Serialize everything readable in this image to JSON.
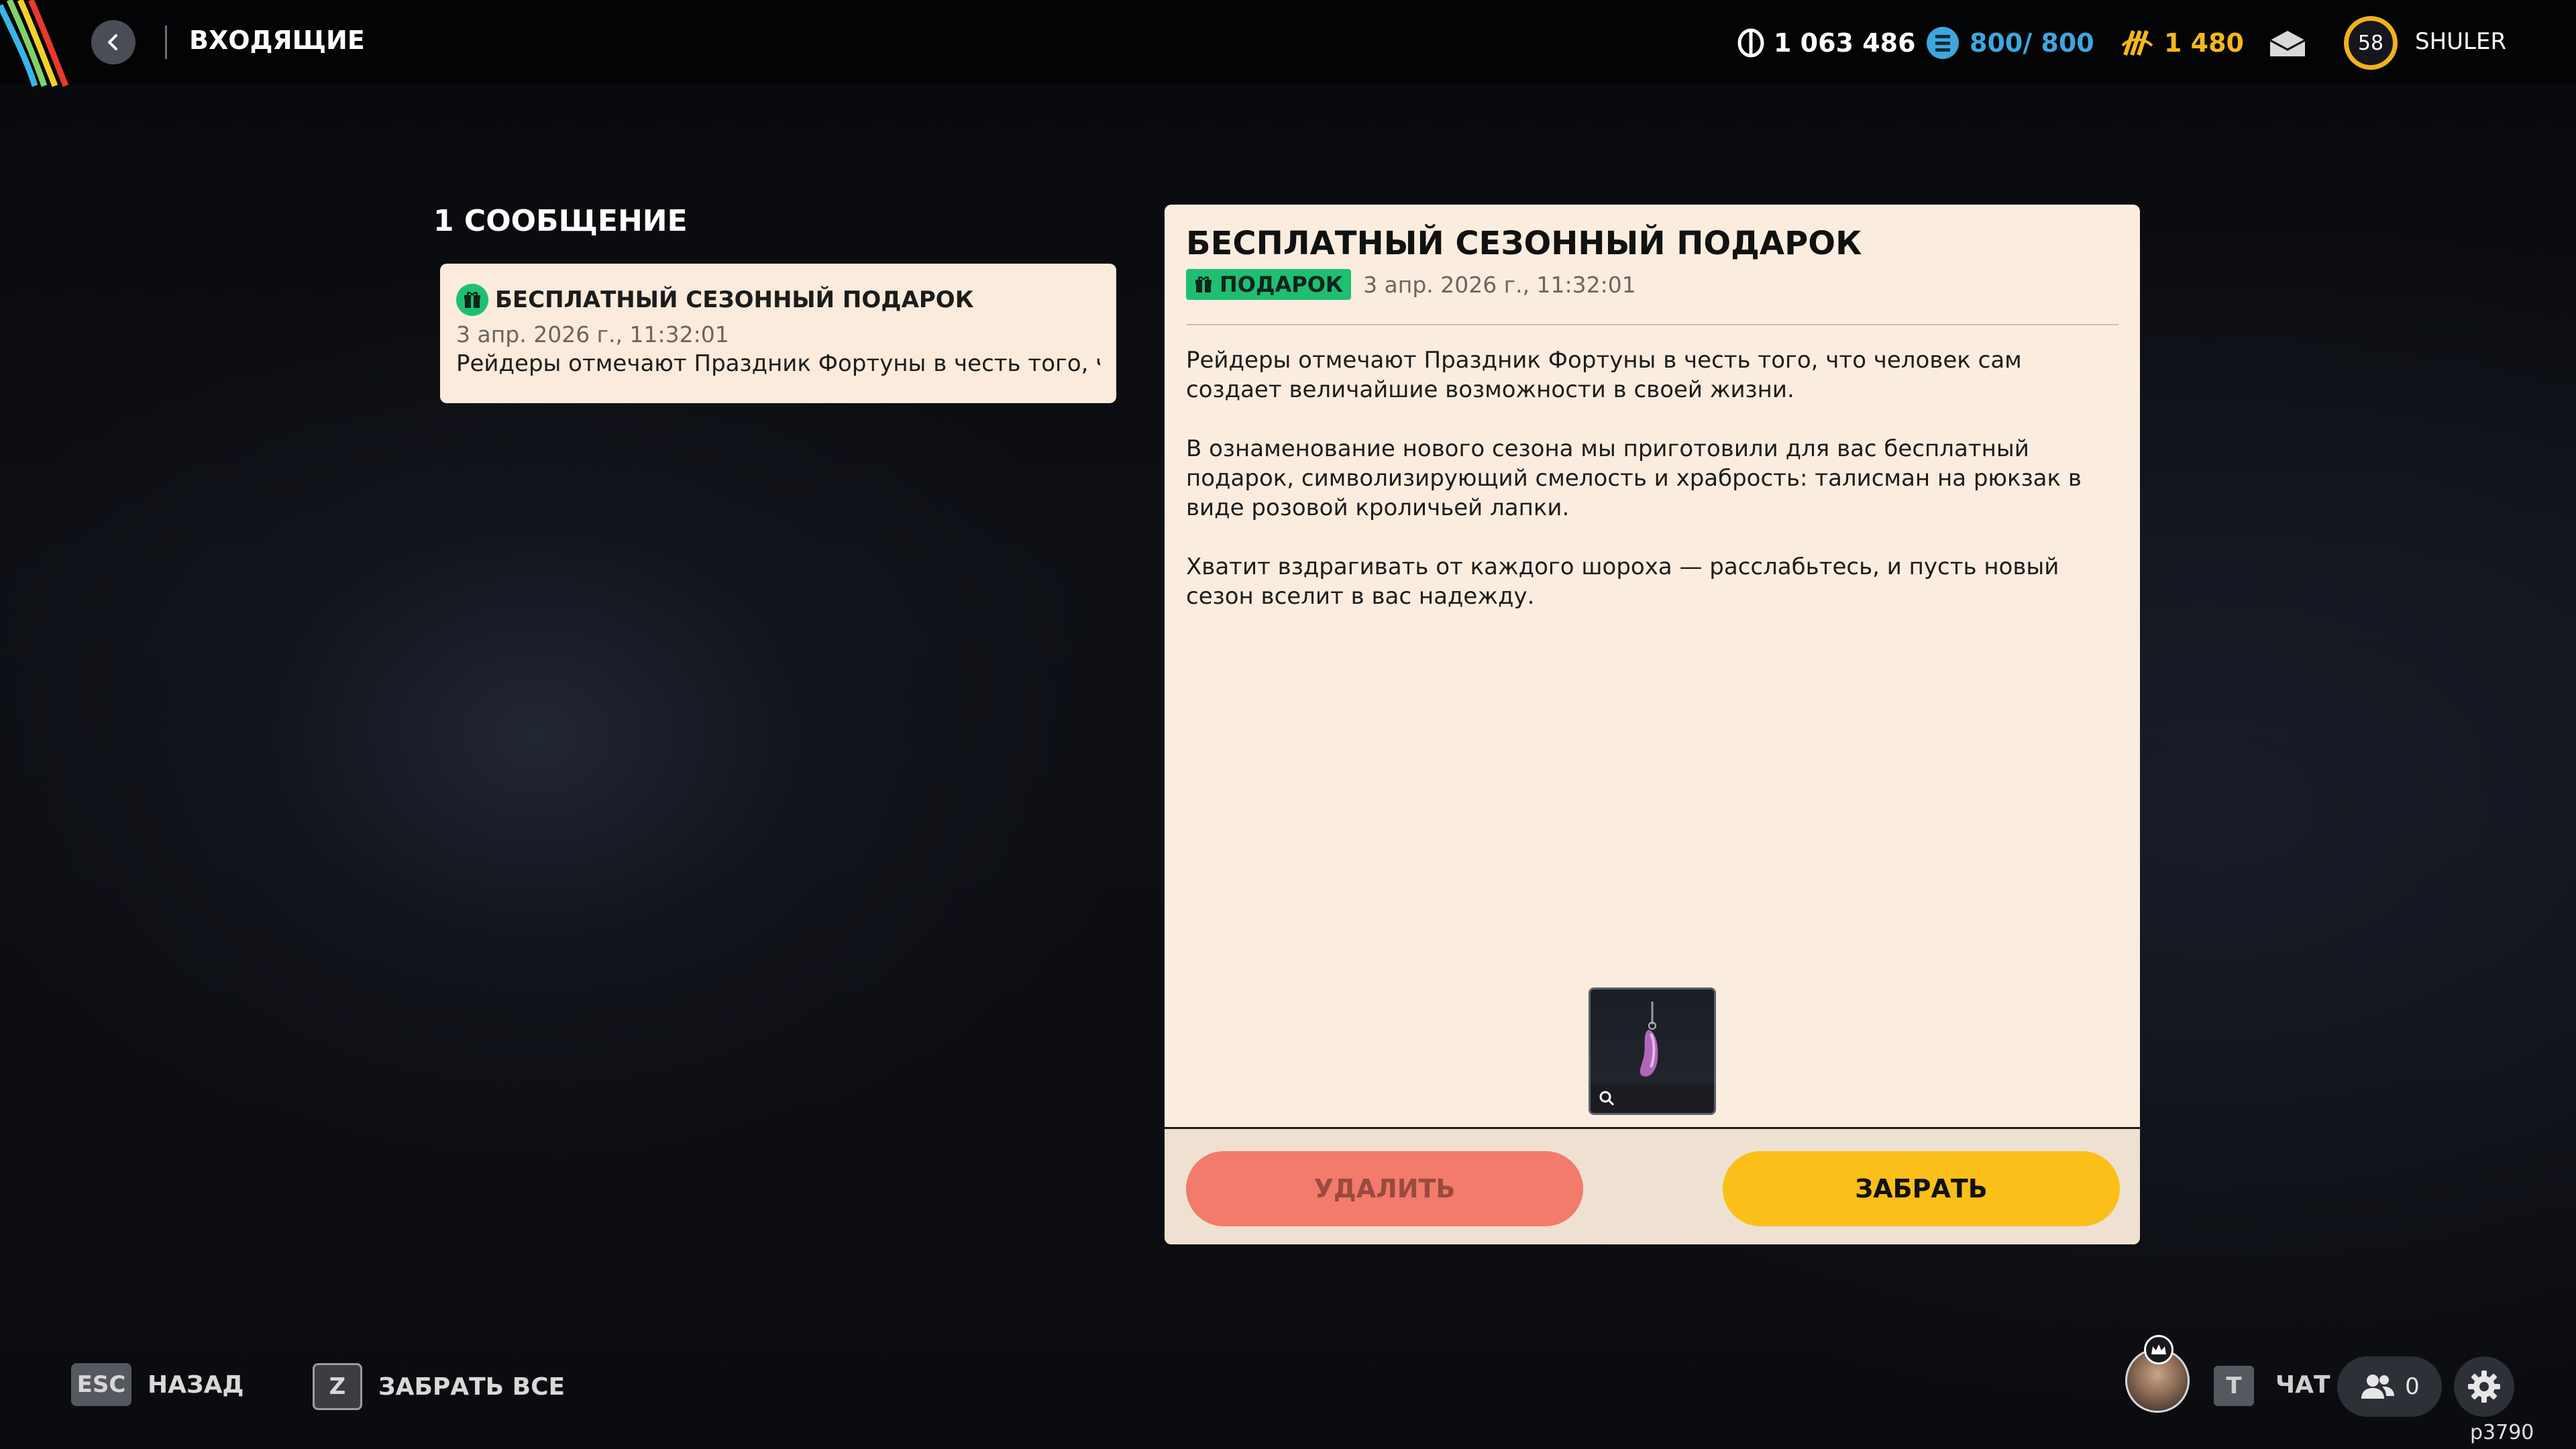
{
  "header": {
    "title": "ВХОДЯЩИЕ",
    "back_icon": "chevron-left-icon",
    "currencies": [
      {
        "name": "coins",
        "value": "1 063 486",
        "icon": "coin-icon",
        "color": "#ffffff"
      },
      {
        "name": "credits",
        "value": "800/ 800",
        "icon": "credit-icon",
        "color": "#3ea6dd"
      },
      {
        "name": "tokens",
        "value": "1 480",
        "icon": "token-icon",
        "color": "#f5b81a"
      }
    ],
    "mail_icon": "mail-icon",
    "level": "58",
    "player_name": "SHULER"
  },
  "inbox": {
    "count_label": "1 СООБЩЕНИЕ",
    "messages": [
      {
        "title": "БЕСПЛАТНЫЙ СЕЗОННЫЙ ПОДАРОК",
        "date": "3 апр. 2026 г., 11:32:01",
        "preview": "Рейдеры отмечают Праздник Фортуны в честь того, что человек сам создает величайшие возможности в своей жизни."
      }
    ]
  },
  "detail": {
    "title": "БЕСПЛАТНЫЙ СЕЗОННЫЙ ПОДАРОК",
    "tag": "ПОДАРОК",
    "date": "3 апр. 2026 г., 11:32:01",
    "paragraphs": [
      "Рейдеры отмечают Праздник Фортуны в честь того, что человек сам создает величайшие возможности в своей жизни.",
      "В ознаменование нового сезона мы приготовили для вас бесплатный подарок, символизирующий смелость и храбрость: талисман на рюкзак в виде розовой кроличьей лапки.",
      "Хватит вздрагивать от каждого шороха — расслабьтесь, и пусть новый сезон вселит в вас надежду."
    ],
    "reward_icon": "rabbit-foot-charm-icon",
    "delete_label": "УДАЛИТЬ",
    "claim_label": "ЗАБРАТЬ"
  },
  "footer": {
    "back_key": "ESC",
    "back_label": "НАЗАД",
    "claim_all_key": "Z",
    "claim_all_label": "ЗАБРАТЬ ВСЕ",
    "chat_key": "T",
    "chat_label": "ЧАТ",
    "friends_count": "0",
    "build_id": "p3790"
  },
  "colors": {
    "card_bg": "#faede0",
    "tag_green": "#1fbf72",
    "delete_button": "#f27b6b",
    "claim_button": "#fbbf1a",
    "level_ring": "#f0b21c"
  }
}
